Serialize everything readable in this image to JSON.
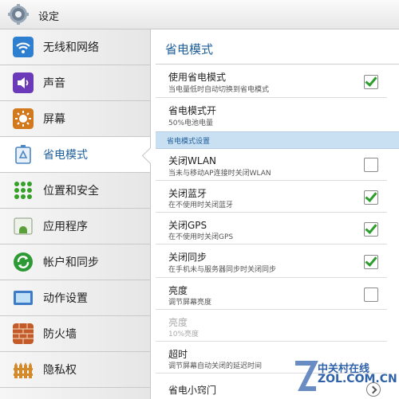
{
  "app": {
    "title": "设定"
  },
  "sidebar": {
    "items": [
      {
        "label": "无线和网络",
        "icon": "wifi-icon",
        "color": "#2f7fd0"
      },
      {
        "label": "声音",
        "icon": "speaker-icon",
        "color": "#6a3ab8"
      },
      {
        "label": "屏幕",
        "icon": "brightness-icon",
        "color": "#d2781d"
      },
      {
        "label": "省电模式",
        "icon": "battery-recycle-icon",
        "color": "#4a86c4",
        "active": true
      },
      {
        "label": "位置和安全",
        "icon": "grid-dots-icon",
        "color": "#37a02a"
      },
      {
        "label": "应用程序",
        "icon": "android-apps-icon",
        "color": "#5aa03a"
      },
      {
        "label": "帐户和同步",
        "icon": "sync-icon",
        "color": "#2e9a35"
      },
      {
        "label": "动作设置",
        "icon": "tablet-icon",
        "color": "#3d7bc6"
      },
      {
        "label": "防火墙",
        "icon": "brick-wall-icon",
        "color": "#c25a2a"
      },
      {
        "label": "隐私权",
        "icon": "fence-icon",
        "color": "#d28a2a"
      }
    ]
  },
  "content": {
    "title": "省电模式",
    "rows": [
      {
        "title": "使用省电模式",
        "subtitle": "当电量低时自动切换到省电模式",
        "checked": true
      },
      {
        "title": "省电模式开",
        "subtitle": "50%电池电量"
      }
    ],
    "section_header": "省电模式设置",
    "settings": [
      {
        "title": "关闭WLAN",
        "subtitle": "当未与移动AP连接时关闭WLAN",
        "checked": false
      },
      {
        "title": "关闭蓝牙",
        "subtitle": "在不使用时关闭蓝牙",
        "checked": true
      },
      {
        "title": "关闭GPS",
        "subtitle": "在不使用时关闭GPS",
        "checked": true
      },
      {
        "title": "关闭同步",
        "subtitle": "在手机未与服务器同步时关闭同步",
        "checked": true
      },
      {
        "title": "亮度",
        "subtitle": "调节屏幕亮度",
        "checked": false
      },
      {
        "title": "亮度",
        "subtitle": "10%亮度",
        "disabled": true
      },
      {
        "title": "超时",
        "subtitle": "调节屏幕自动关闭的延迟时间"
      },
      {
        "title": "省电小窍门"
      }
    ]
  },
  "watermark": {
    "line1": "中关村在线",
    "line2": "ZOL.COM.CN"
  }
}
